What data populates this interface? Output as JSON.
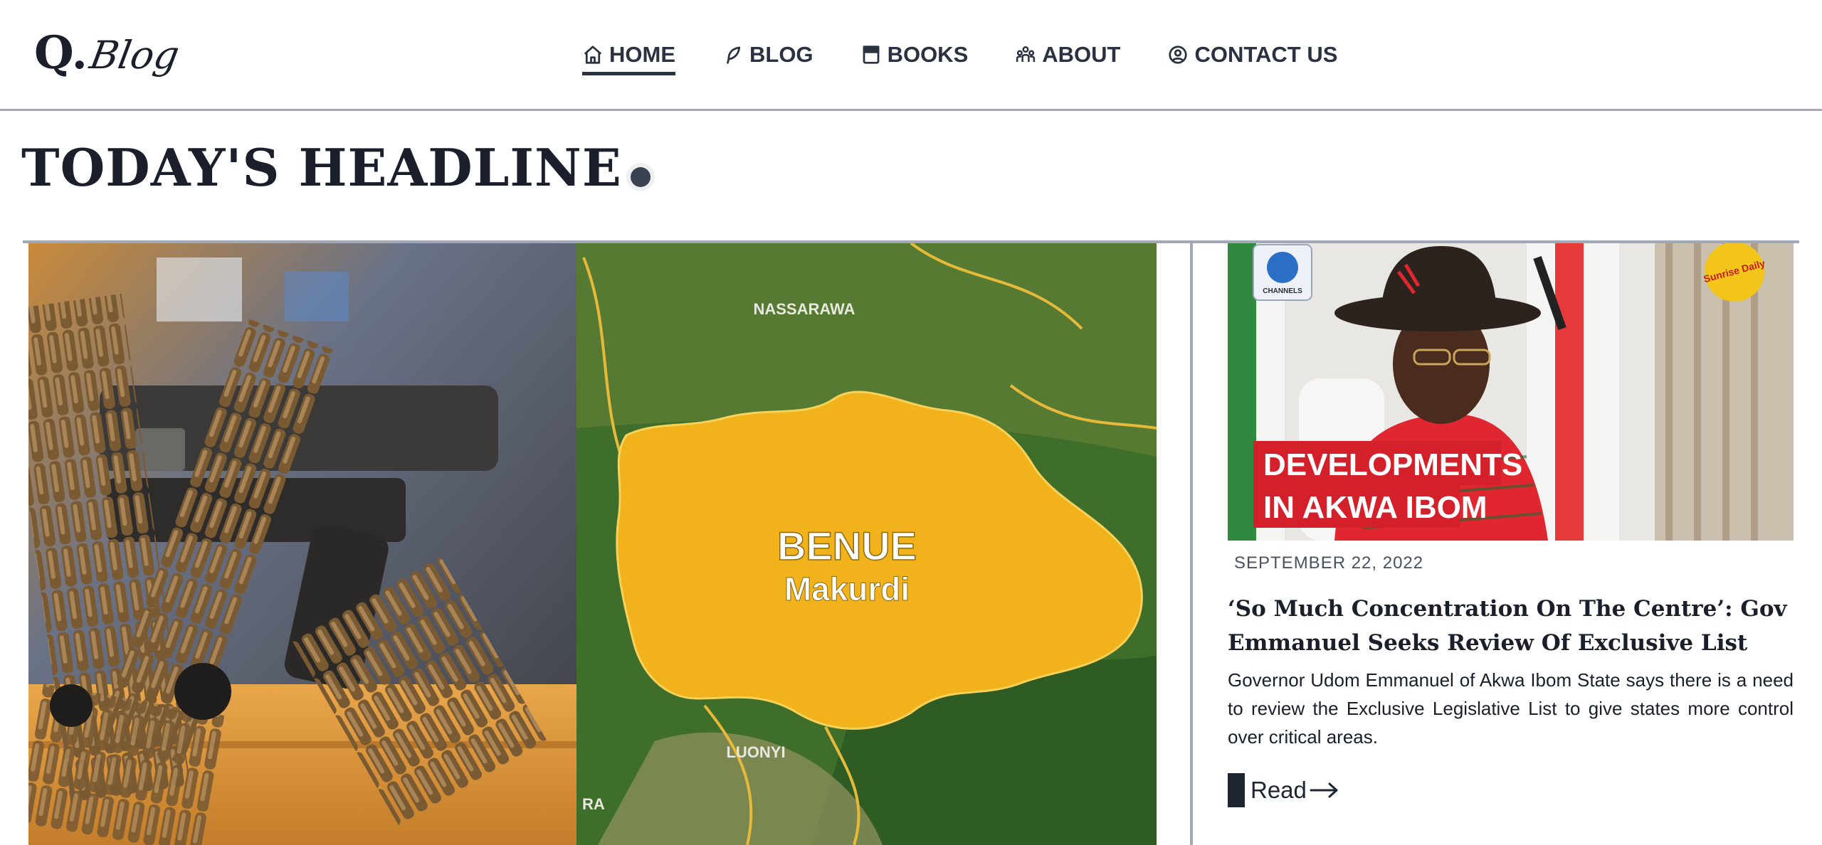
{
  "brand": {
    "logo_mark": "Q.",
    "logo_word": "Blog"
  },
  "nav": {
    "items": [
      {
        "label": "HOME",
        "icon": "home-icon",
        "active": true
      },
      {
        "label": "BLOG",
        "icon": "feather-icon",
        "active": false
      },
      {
        "label": "BOOKS",
        "icon": "book-icon",
        "active": false
      },
      {
        "label": "ABOUT",
        "icon": "users-icon",
        "active": false
      },
      {
        "label": "CONTACT US",
        "icon": "contact-icon",
        "active": false
      }
    ]
  },
  "headline": {
    "title": "TODAY'S HEADLINE"
  },
  "main_story": {
    "image_labels": {
      "state": "BENUE",
      "capital": "Makurdi",
      "north": "NASSARAWA",
      "south": "LUONYI",
      "west": "RA"
    }
  },
  "side_story": {
    "image_caption": {
      "line1": "DEVELOPMENTS",
      "line2": "IN AKWA IBOM",
      "channel": "CHANNELS",
      "sticker": "Sunrise Daily"
    },
    "date": "SEPTEMBER 22, 2022",
    "title": "‘So Much Concentration On The Centre’: Gov Emmanuel Seeks Review Of Exclusive List",
    "excerpt": "Governor Udom Emmanuel of Akwa Ibom State says there is a need to review the Exclusive Legislative List to give states more control over critical areas.",
    "read_label": "Read"
  },
  "colors": {
    "text": "#1e2533",
    "rule": "#a2a9b6",
    "benue": "#f2b21c",
    "caption_red": "#d4202a"
  }
}
